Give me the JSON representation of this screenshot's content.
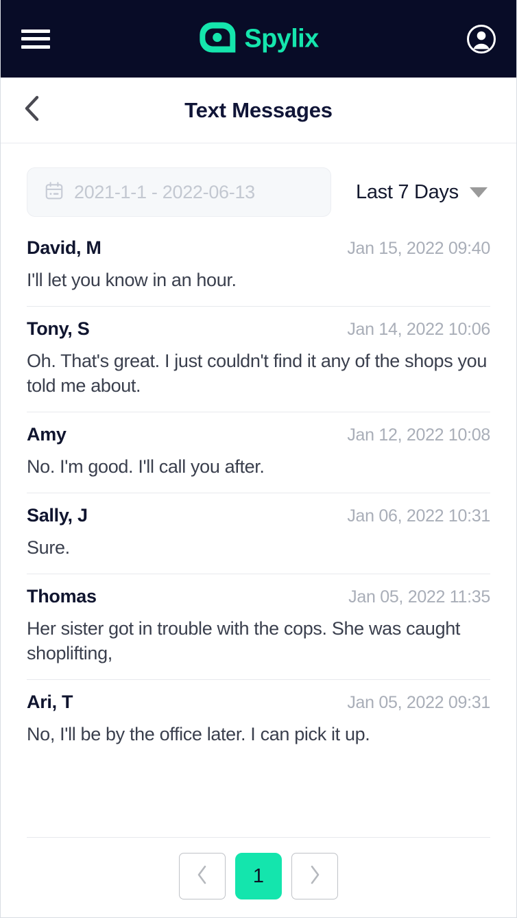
{
  "topbar": {
    "menu_icon": "hamburger-menu-icon",
    "brand_name": "Spylix",
    "brand_mark_icon": "spylix-eye-logo-icon",
    "account_icon": "user-account-icon",
    "background_color": "#080c27",
    "brand_color": "#15e5ad"
  },
  "titlebar": {
    "back_icon": "chevron-left-icon",
    "title": "Text Messages"
  },
  "filters": {
    "date_range": {
      "icon": "calendar-icon",
      "placeholder": "2021-1-1 - 2022-06-13",
      "value": ""
    },
    "range_select": {
      "selected": "Last 7 Days",
      "caret_icon": "caret-down-icon"
    }
  },
  "messages": [
    {
      "name": "David, M",
      "time": "Jan 15, 2022 09:40",
      "text": "I'll let you know in an hour."
    },
    {
      "name": "Tony, S",
      "time": "Jan 14, 2022 10:06",
      "text": "Oh. That's great. I just couldn't find it any of the shops you told me about."
    },
    {
      "name": "Amy",
      "time": "Jan 12, 2022 10:08",
      "text": "No. I'm good. I'll call you after."
    },
    {
      "name": "Sally, J",
      "time": "Jan 06, 2022 10:31",
      "text": "Sure."
    },
    {
      "name": "Thomas",
      "time": "Jan 05, 2022 11:35",
      "text": "Her sister got in trouble with the cops. She was caught shoplifting,"
    },
    {
      "name": "Ari, T",
      "time": "Jan 05, 2022 09:31",
      "text": "No, I'll be by the office later. I can pick it up."
    }
  ],
  "pagination": {
    "prev_icon": "chevron-left-icon",
    "next_icon": "chevron-right-icon",
    "current_page": "1",
    "active_color": "#14e5ad"
  }
}
